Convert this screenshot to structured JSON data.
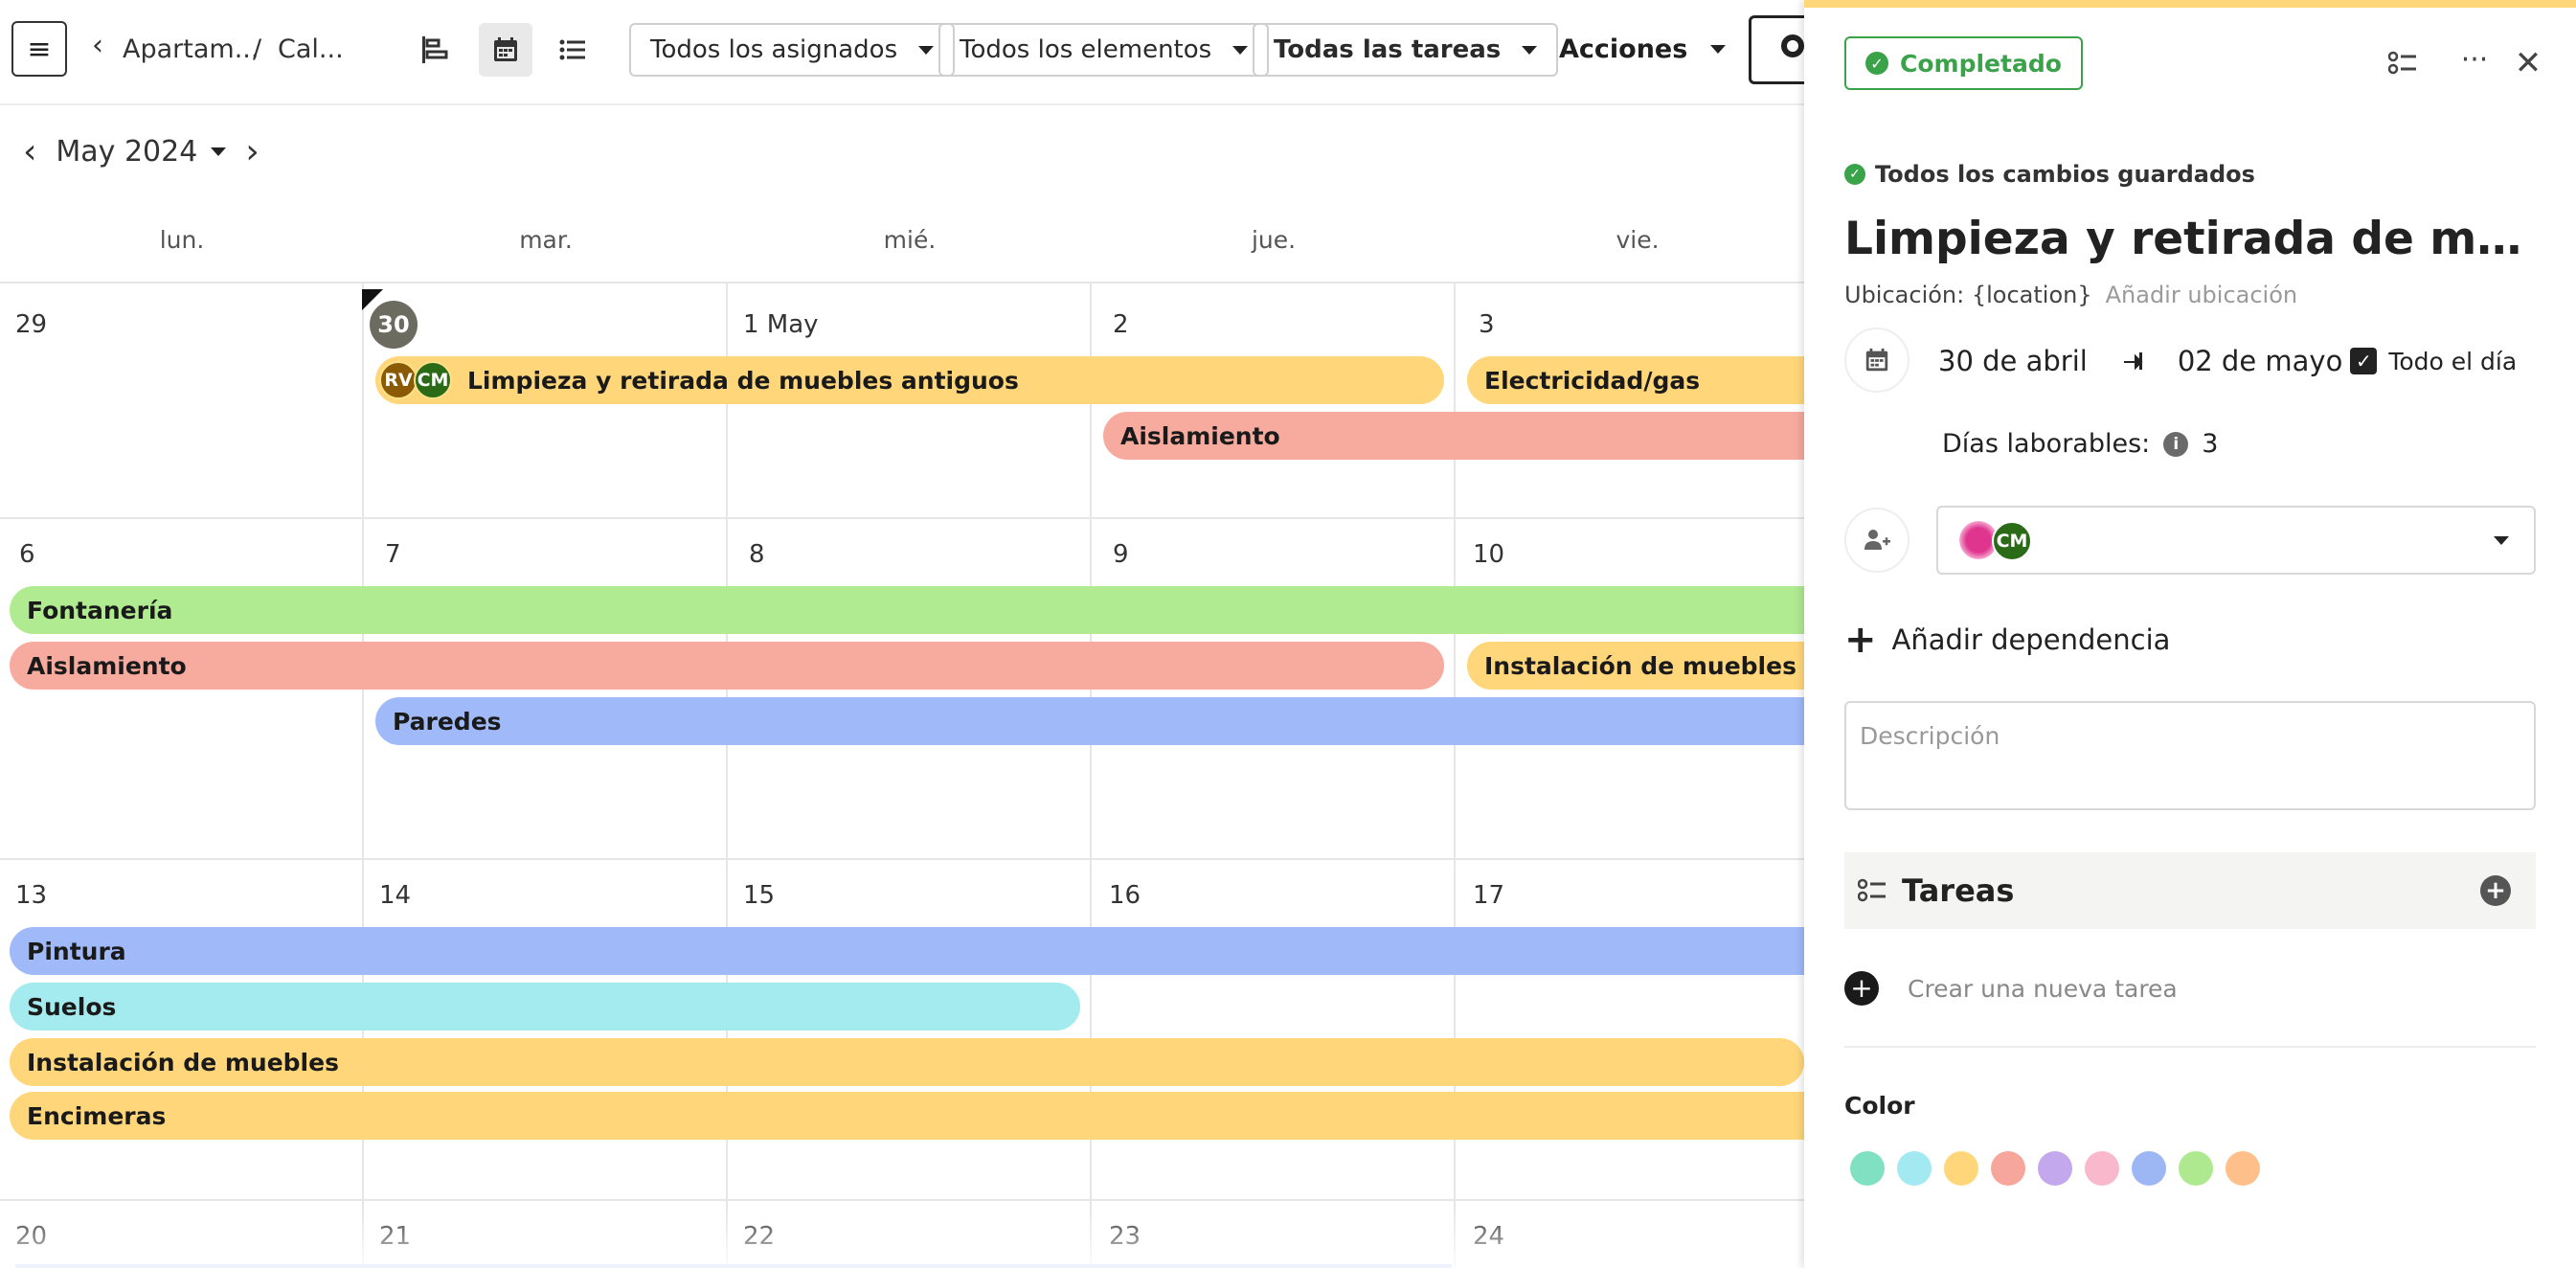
{
  "toolbar": {
    "breadcrumb_1": "Apartam...",
    "breadcrumb_sep": "/",
    "breadcrumb_2": "Cal...",
    "filter_assignees": "Todos los asignados",
    "filter_elements": "Todos los elementos",
    "filter_tasks": "Todas las tareas",
    "actions": "Acciones"
  },
  "calendar": {
    "month_label": "May 2024",
    "weekdays": [
      "lun.",
      "mar.",
      "mié.",
      "jue.",
      "vie."
    ],
    "weeks": [
      [
        "29",
        "30",
        "1 May",
        "2",
        "3"
      ],
      [
        "6",
        "7",
        "8",
        "9",
        "10"
      ],
      [
        "13",
        "14",
        "15",
        "16",
        "17"
      ],
      [
        "20",
        "21",
        "22",
        "23",
        "24"
      ]
    ],
    "events": {
      "limpieza": "Limpieza y retirada de muebles antiguos",
      "limpieza_avatar_1": "RV",
      "limpieza_avatar_2": "CM",
      "electricidad": "Electricidad/gas",
      "aislamiento_w1": "Aislamiento",
      "fontaneria": "Fontanería",
      "aislamiento_w2": "Aislamiento",
      "instalacion_w2": "Instalación de muebles",
      "paredes": "Paredes",
      "pintura": "Pintura",
      "suelos": "Suelos",
      "instalacion_w3": "Instalación de muebles",
      "encimeras": "Encimeras"
    }
  },
  "panel": {
    "status_label": "Completado",
    "saved_label": "Todos los cambios guardados",
    "title": "Limpieza y retirada de muebles ...",
    "location_label": "Ubicación: {location}",
    "add_location": "Añadir ubicación",
    "start_date": "30 de abril",
    "end_date": "02 de mayo",
    "all_day": "Todo el día",
    "workdays_label": "Días laborables:",
    "workdays_value": "3",
    "assignee_avatar": "CM",
    "add_dependency": "Añadir dependencia",
    "description_placeholder": "Descripción",
    "tasks_header": "Tareas",
    "new_task": "Crear una nueva tarea",
    "color_label": "Color",
    "colors": [
      "#7fe0c2",
      "#a2e9f2",
      "#ffd77a",
      "#f6a69b",
      "#c3a8ee",
      "#f9b8cb",
      "#9db7f5",
      "#aee88f",
      "#ffbf8a"
    ]
  },
  "colors": {
    "yellow": "#ffd77a",
    "salmon": "#f7aa9e",
    "green": "#b0ea91",
    "blue": "#a0b9f9",
    "cyan": "#a4ebef",
    "completed": "#3aa34a"
  }
}
